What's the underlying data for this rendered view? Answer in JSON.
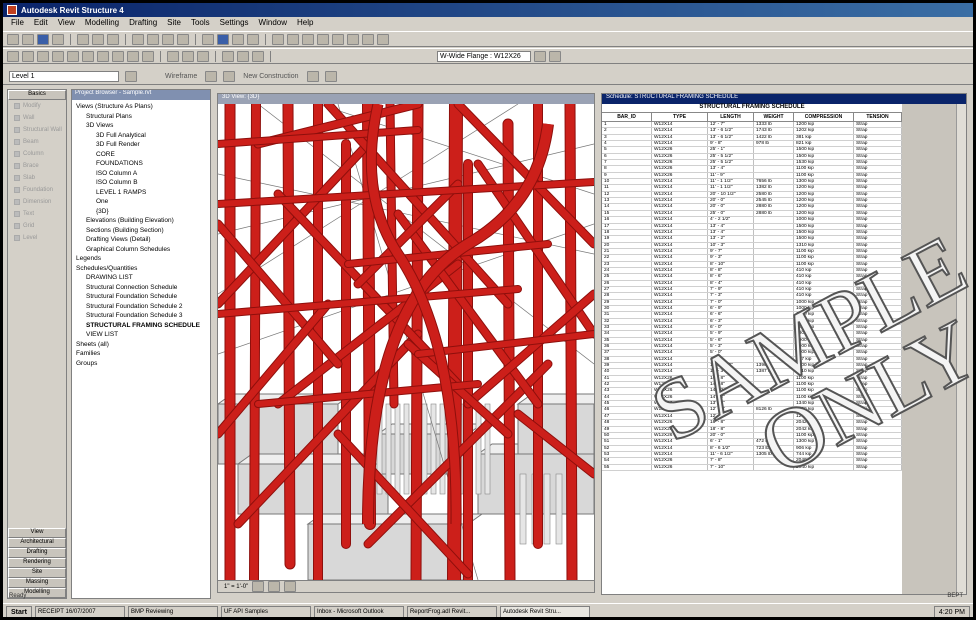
{
  "app": {
    "title": "Autodesk Revit Structure 4"
  },
  "menu": [
    "File",
    "Edit",
    "View",
    "Modelling",
    "Drafting",
    "Site",
    "Tools",
    "Settings",
    "Window",
    "Help"
  ],
  "options_bar": {
    "level_label": "Level 1",
    "wireframe": "Wireframe",
    "phase": "New Construction"
  },
  "type_selector": "W-Wide Flange : W12X26",
  "design_bar": {
    "header": "Basics",
    "tools": [
      "Modify",
      "Wall",
      "Structural Wall",
      "Beam",
      "Column",
      "Brace",
      "Slab",
      "Foundation",
      "Dimension",
      "Text",
      "Grid",
      "Level"
    ],
    "tabs": [
      "View",
      "Architectural",
      "Drafting",
      "Rendering",
      "Site",
      "Massing",
      "Modelling"
    ]
  },
  "browser": {
    "title": "Project Browser - Sample.rvt",
    "tree": [
      {
        "t": "Views (Structure As Plans)",
        "d": 0
      },
      {
        "t": "Structural Plans",
        "d": 1
      },
      {
        "t": "3D Views",
        "d": 1
      },
      {
        "t": "3D Full Analytical",
        "d": 2
      },
      {
        "t": "3D Full Render",
        "d": 2
      },
      {
        "t": "CORE",
        "d": 2
      },
      {
        "t": "FOUNDATIONS",
        "d": 2
      },
      {
        "t": "ISO Column A",
        "d": 2
      },
      {
        "t": "ISO Column B",
        "d": 2
      },
      {
        "t": "LEVEL 1 RAMPS",
        "d": 2
      },
      {
        "t": "One",
        "d": 2
      },
      {
        "t": "{3D}",
        "d": 2
      },
      {
        "t": "Elevations (Building Elevation)",
        "d": 1
      },
      {
        "t": "Sections (Building Section)",
        "d": 1
      },
      {
        "t": "Drafting Views (Detail)",
        "d": 1
      },
      {
        "t": "Graphical Column Schedules",
        "d": 1
      },
      {
        "t": "Legends",
        "d": 0
      },
      {
        "t": "Schedules/Quantities",
        "d": 0
      },
      {
        "t": "DRAWING LIST",
        "d": 1
      },
      {
        "t": "Structural Connection Schedule",
        "d": 1
      },
      {
        "t": "Structural Foundation Schedule",
        "d": 1
      },
      {
        "t": "Structural Foundation Schedule 2",
        "d": 1
      },
      {
        "t": "Structural Foundation Schedule 3",
        "d": 1
      },
      {
        "t": "STRUCTURAL FRAMING SCHEDULE",
        "d": 1,
        "b": true
      },
      {
        "t": "VIEW LIST",
        "d": 1
      },
      {
        "t": "Sheets (all)",
        "d": 0
      },
      {
        "t": "Families",
        "d": 0
      },
      {
        "t": "Groups",
        "d": 0
      }
    ]
  },
  "view3d": {
    "title": "3D View: {3D}",
    "scale": "1\" = 1'-0\""
  },
  "schedule": {
    "window_title": "Schedule: STRUCTURAL FRAMING SCHEDULE",
    "title": "STRUCTURAL FRAMING SCHEDULE",
    "columns": [
      "BAR_ID",
      "TYPE",
      "LENGTH",
      "WEIGHT",
      "COMPRESSION",
      "TENSION"
    ],
    "rows": [
      [
        "1",
        "W12X14",
        "12' - 7\"",
        "1333 lb",
        "1200 kip",
        "Strap"
      ],
      [
        "2",
        "W12X14",
        "13' - 6 1/2\"",
        "1743 lb",
        "1202 kip",
        "Strap"
      ],
      [
        "3",
        "W12X14",
        "13' - 6 1/2\"",
        "1422 lb",
        "381 kip",
        "Strap"
      ],
      [
        "4",
        "W12X14",
        "9' - 8\"",
        "978 lb",
        "821 kip",
        "Strap"
      ],
      [
        "5",
        "W12X26",
        "25' - 1\"",
        "",
        "1500 kip",
        "Strap"
      ],
      [
        "6",
        "W12X26",
        "25' - 5 1/2\"",
        "",
        "1500 kip",
        "Strap"
      ],
      [
        "7",
        "W12X26",
        "25' - 5 1/2\"",
        "",
        "1530 kip",
        "Strap"
      ],
      [
        "8",
        "W12X26",
        "13' - 4\"",
        "",
        "1100 kip",
        "Strap"
      ],
      [
        "9",
        "W12X26",
        "11' - 9\"",
        "",
        "1100 kip",
        "Strap"
      ],
      [
        "10",
        "W12X14",
        "11' - 1 1/2\"",
        "7656 lb",
        "1300 kip",
        "Strap"
      ],
      [
        "11",
        "W12X14",
        "11' - 1 1/2\"",
        "1382 lb",
        "1200 kip",
        "Strap"
      ],
      [
        "12",
        "W12X14",
        "20' - 10 1/2\"",
        "2580 lb",
        "1200 kip",
        "Strap"
      ],
      [
        "13",
        "W12X14",
        "20' - 0\"",
        "2545 lb",
        "1200 kip",
        "Strap"
      ],
      [
        "14",
        "W12X14",
        "20' - 0\"",
        "2880 lb",
        "1200 kip",
        "Strap"
      ],
      [
        "15",
        "W12X14",
        "25' - 0\"",
        "2880 lb",
        "1200 kip",
        "Strap"
      ],
      [
        "16",
        "W12X14",
        "4' - 2 1/2\"",
        "",
        "1000 kip",
        "Strap"
      ],
      [
        "17",
        "W12X14",
        "13' - 4\"",
        "",
        "1500 kip",
        "Strap"
      ],
      [
        "18",
        "W12X14",
        "13' - 4\"",
        "",
        "1500 kip",
        "Strap"
      ],
      [
        "19",
        "W12X14",
        "13' - 2\"",
        "",
        "1500 kip",
        "Strap"
      ],
      [
        "20",
        "W12X14",
        "10' - 3\"",
        "",
        "1310 kip",
        "Strap"
      ],
      [
        "21",
        "W12X14",
        "9' - 7\"",
        "",
        "1100 kip",
        "Strap"
      ],
      [
        "22",
        "W12X14",
        "9' - 3\"",
        "",
        "1100 kip",
        "Strap"
      ],
      [
        "23",
        "W12X14",
        "8' - 10\"",
        "",
        "1100 kip",
        "Strap"
      ],
      [
        "24",
        "W12X14",
        "8' - 8\"",
        "",
        "410 kip",
        "Strap"
      ],
      [
        "25",
        "W12X14",
        "8' - 6\"",
        "",
        "410 kip",
        "Strap"
      ],
      [
        "26",
        "W12X14",
        "8' - 4\"",
        "",
        "410 kip",
        "Strap"
      ],
      [
        "27",
        "W12X14",
        "7' - 9\"",
        "",
        "410 kip",
        "Strap"
      ],
      [
        "28",
        "W12X14",
        "7' - 3\"",
        "",
        "410 kip",
        "Strap"
      ],
      [
        "29",
        "W12X14",
        "7' - 0\"",
        "",
        "1000 kip",
        "Strap"
      ],
      [
        "30",
        "W12X14",
        "6' - 9\"",
        "",
        "1000 kip",
        "Strap"
      ],
      [
        "31",
        "W12X14",
        "6' - 6\"",
        "",
        "1000 kip",
        "Strap"
      ],
      [
        "32",
        "W12X14",
        "6' - 3\"",
        "",
        "1000 kip",
        "Strap"
      ],
      [
        "33",
        "W12X14",
        "6' - 0\"",
        "",
        "1000 kip",
        "Strap"
      ],
      [
        "34",
        "W12X14",
        "5' - 9\"",
        "",
        "1000 kip",
        "Strap"
      ],
      [
        "35",
        "W12X14",
        "5' - 6\"",
        "",
        "1000 kip",
        "Strap"
      ],
      [
        "36",
        "W12X14",
        "5' - 3\"",
        "",
        "1000 kip",
        "Strap"
      ],
      [
        "37",
        "W12X14",
        "5' - 0\"",
        "",
        "1000 kip",
        "Strap"
      ],
      [
        "38",
        "W12X14",
        "4' - 9\"",
        "",
        "307 kip",
        "Strap"
      ],
      [
        "39",
        "W12X14",
        "13' - 3 1/2\"",
        "1390 lb",
        "1200 kip",
        "Strap"
      ],
      [
        "40",
        "W12X14",
        "13' - 3 1/2\"",
        "1387 lb",
        "1210 kip",
        "Strap"
      ],
      [
        "41",
        "W12X26",
        "14' - 8\"",
        "",
        "1100 kip",
        "Strap"
      ],
      [
        "42",
        "W12X26",
        "14' - 8\"",
        "",
        "1100 kip",
        "Strap"
      ],
      [
        "43",
        "W12X26",
        "14' - 2 1/2\"",
        "",
        "1100 kip",
        "Strap"
      ],
      [
        "44",
        "W12X26",
        "14' - 2\"",
        "",
        "1100 kip",
        "Strap"
      ],
      [
        "45",
        "W12X26",
        "13' - 2\"",
        "",
        "1340 kip",
        "Strap"
      ],
      [
        "46",
        "W12X14",
        "12' - 7\"",
        "8126 lb",
        "1200 kip",
        "Strap"
      ],
      [
        "47",
        "W12X14",
        "12' - 7\"",
        "",
        "1200 kip",
        "Strap"
      ],
      [
        "48",
        "W12X26",
        "18' - 8\"",
        "",
        "2042 kip",
        "Strap"
      ],
      [
        "49",
        "W12X26",
        "18' - 8\"",
        "",
        "2042 kip",
        "Strap"
      ],
      [
        "50",
        "W12X26",
        "20' - 0\"",
        "",
        "1100 kip",
        "Strap"
      ],
      [
        "51",
        "W12X14",
        "6' - 1\"",
        "472 lb",
        "1300 kip",
        "Strap"
      ],
      [
        "52",
        "W12X14",
        "8' - 6 1/2\"",
        "723 lb",
        "906 kip",
        "Strap"
      ],
      [
        "53",
        "W12X14",
        "11' - 6 1/2\"",
        "1305 lb",
        "744 kip",
        "Strap"
      ],
      [
        "54",
        "W12X26",
        "7' - 8\"",
        "",
        "2040 kip",
        "Strap"
      ],
      [
        "55",
        "W12X26",
        "7' - 10\"",
        "",
        "2040 kip",
        "Strap"
      ]
    ]
  },
  "watermark": [
    "SAMPLE",
    "ONLY"
  ],
  "status_bar": {
    "left": "Ready",
    "right": "BEPT"
  },
  "taskbar": {
    "start": "Start",
    "tasks": [
      "RECEIPT 16/07/2007",
      "BMP Reviewing",
      "UF API Samples",
      "Inbox - Microsoft Outlook",
      "ReportFrog.adl Revit...",
      "Autodesk Revit Stru..."
    ],
    "clock": "4:20 PM"
  },
  "colors": {
    "steel": "#cc1f1a",
    "steel_dark": "#8e0f0c",
    "title_active": "#0a246a",
    "concrete": "#d8d8d8"
  }
}
